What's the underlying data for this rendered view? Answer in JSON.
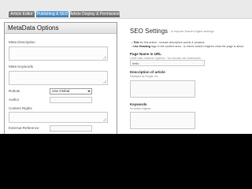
{
  "tabs": [
    {
      "label": "Article Editor",
      "active": false
    },
    {
      "label": "Publishing & SEO",
      "active": true
    },
    {
      "label": "Article Display & Permissions",
      "active": false
    }
  ],
  "seo_panel": {
    "title": "SEO Settings",
    "subtitle": "to improve Search Engine rankings",
    "bullets": [
      {
        "strong": "Title",
        "text": "for this article - include descriptive words & phrases"
      },
      {
        "strong": "Use Heading",
        "text": "tags in the content area - to inform search engines what the page is about"
      }
    ],
    "page_name": {
      "label": "Page Name in URL",
      "hint": "Lower case, numbers, hyphens - You can also use underscores.",
      "value": "hello"
    },
    "description": {
      "label": "Description of article",
      "hint": "Displayed by Google, etc."
    },
    "keywords": {
      "label": "Keywords",
      "hint": "for search engines"
    }
  },
  "metadata_modal": {
    "title": "MetaData Options",
    "meta_description_label": "Meta Description",
    "meta_keywords_label": "Meta Keywords",
    "robots_label": "Robots",
    "robots_value": "Use Global",
    "author_label": "Author",
    "content_rights_label": "Content Rights",
    "external_reference_label": "External Reference"
  },
  "colors": {
    "tab_active": "#4a8cc4",
    "tab_inactive": "#7a7a7a",
    "overlay_bottom": "#000000"
  }
}
